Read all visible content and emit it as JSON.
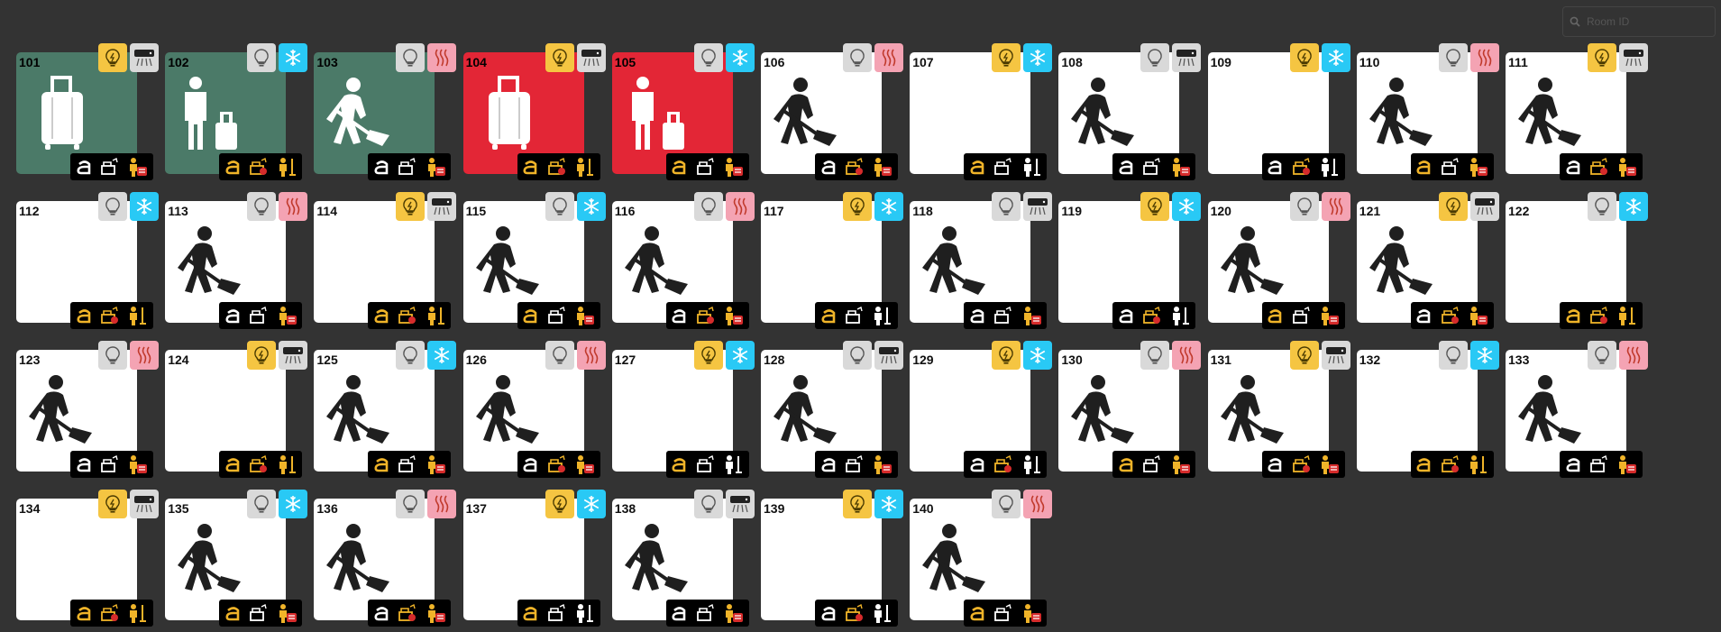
{
  "search": {
    "placeholder": "Room ID"
  },
  "colors": {
    "background": "#333333",
    "vacant": "#ffffff",
    "occupied": "#4b7a68",
    "alert": "#e32636",
    "light_on": "#f5c542",
    "light_off": "#d9d9d9",
    "cool": "#29c9f5",
    "heat": "#f4a3b3",
    "fan": "#d9d9d9"
  },
  "rooms": [
    {
      "number": "101",
      "status": "occupied",
      "hero": "luggage-icon",
      "light": "on",
      "hvac": "fan",
      "tags": [
        "white",
        "white",
        "gold-red"
      ]
    },
    {
      "number": "102",
      "status": "occupied",
      "hero": "guests-icon",
      "light": "off",
      "hvac": "cool",
      "tags": [
        "gold",
        "gold-red",
        "gold-gold"
      ]
    },
    {
      "number": "103",
      "status": "occupied",
      "hero": "cleaning-icon",
      "light": "off",
      "hvac": "heat",
      "tags": [
        "white",
        "white",
        "gold-red"
      ]
    },
    {
      "number": "104",
      "status": "alert",
      "hero": "luggage-icon",
      "light": "on",
      "hvac": "fan",
      "tags": [
        "gold",
        "gold-red",
        "gold-gold"
      ]
    },
    {
      "number": "105",
      "status": "alert",
      "hero": "guests-icon",
      "light": "off",
      "hvac": "cool",
      "tags": [
        "gold",
        "white",
        "gold-red"
      ]
    },
    {
      "number": "106",
      "status": "vacant",
      "hero": "cleaning-icon",
      "light": "off",
      "hvac": "heat",
      "tags": [
        "white",
        "gold-red",
        "gold-red"
      ]
    },
    {
      "number": "107",
      "status": "vacant",
      "hero": "",
      "light": "on",
      "hvac": "cool",
      "tags": [
        "gold",
        "white",
        "white-white"
      ]
    },
    {
      "number": "108",
      "status": "vacant",
      "hero": "cleaning-icon",
      "light": "off",
      "hvac": "fan",
      "tags": [
        "white",
        "white",
        "gold-red"
      ]
    },
    {
      "number": "109",
      "status": "vacant",
      "hero": "",
      "light": "on",
      "hvac": "cool",
      "tags": [
        "white",
        "gold-red",
        "white-white"
      ]
    },
    {
      "number": "110",
      "status": "vacant",
      "hero": "cleaning-icon",
      "light": "off",
      "hvac": "heat",
      "tags": [
        "gold",
        "white",
        "gold-red"
      ]
    },
    {
      "number": "111",
      "status": "vacant",
      "hero": "cleaning-icon",
      "light": "on",
      "hvac": "fan",
      "tags": [
        "white",
        "gold-red",
        "gold-red"
      ]
    },
    {
      "number": "112",
      "status": "vacant",
      "hero": "",
      "light": "off",
      "hvac": "cool",
      "tags": [
        "gold",
        "gold-red",
        "gold-gold"
      ]
    },
    {
      "number": "113",
      "status": "vacant",
      "hero": "cleaning-icon",
      "light": "off",
      "hvac": "heat",
      "tags": [
        "white",
        "white",
        "gold-red"
      ]
    },
    {
      "number": "114",
      "status": "vacant",
      "hero": "",
      "light": "on",
      "hvac": "fan",
      "tags": [
        "gold",
        "gold-red",
        "gold-gold"
      ]
    },
    {
      "number": "115",
      "status": "vacant",
      "hero": "cleaning-icon",
      "light": "off",
      "hvac": "cool",
      "tags": [
        "gold",
        "white",
        "gold-red"
      ]
    },
    {
      "number": "116",
      "status": "vacant",
      "hero": "cleaning-icon",
      "light": "off",
      "hvac": "heat",
      "tags": [
        "white",
        "gold-red",
        "gold-red"
      ]
    },
    {
      "number": "117",
      "status": "vacant",
      "hero": "",
      "light": "on",
      "hvac": "cool",
      "tags": [
        "gold",
        "white",
        "white-white"
      ]
    },
    {
      "number": "118",
      "status": "vacant",
      "hero": "cleaning-icon",
      "light": "off",
      "hvac": "fan",
      "tags": [
        "white",
        "white",
        "gold-red"
      ]
    },
    {
      "number": "119",
      "status": "vacant",
      "hero": "",
      "light": "on",
      "hvac": "cool",
      "tags": [
        "white",
        "gold-red",
        "white-white"
      ]
    },
    {
      "number": "120",
      "status": "vacant",
      "hero": "cleaning-icon",
      "light": "off",
      "hvac": "heat",
      "tags": [
        "gold",
        "white",
        "gold-red"
      ]
    },
    {
      "number": "121",
      "status": "vacant",
      "hero": "cleaning-icon",
      "light": "on",
      "hvac": "fan",
      "tags": [
        "white",
        "gold-red",
        "gold-red"
      ]
    },
    {
      "number": "122",
      "status": "vacant",
      "hero": "",
      "light": "off",
      "hvac": "cool",
      "tags": [
        "gold",
        "gold-red",
        "gold-gold"
      ]
    },
    {
      "number": "123",
      "status": "vacant",
      "hero": "cleaning-icon",
      "light": "off",
      "hvac": "heat",
      "tags": [
        "white",
        "white",
        "gold-red"
      ]
    },
    {
      "number": "124",
      "status": "vacant",
      "hero": "",
      "light": "on",
      "hvac": "fan",
      "tags": [
        "gold",
        "gold-red",
        "gold-gold"
      ]
    },
    {
      "number": "125",
      "status": "vacant",
      "hero": "cleaning-icon",
      "light": "off",
      "hvac": "cool",
      "tags": [
        "gold",
        "white",
        "gold-red"
      ]
    },
    {
      "number": "126",
      "status": "vacant",
      "hero": "cleaning-icon",
      "light": "off",
      "hvac": "heat",
      "tags": [
        "white",
        "gold-red",
        "gold-red"
      ]
    },
    {
      "number": "127",
      "status": "vacant",
      "hero": "",
      "light": "on",
      "hvac": "cool",
      "tags": [
        "gold",
        "white",
        "white-white"
      ]
    },
    {
      "number": "128",
      "status": "vacant",
      "hero": "cleaning-icon",
      "light": "off",
      "hvac": "fan",
      "tags": [
        "white",
        "white",
        "gold-red"
      ]
    },
    {
      "number": "129",
      "status": "vacant",
      "hero": "",
      "light": "on",
      "hvac": "cool",
      "tags": [
        "white",
        "gold-red",
        "white-white"
      ]
    },
    {
      "number": "130",
      "status": "vacant",
      "hero": "cleaning-icon",
      "light": "off",
      "hvac": "heat",
      "tags": [
        "gold",
        "white",
        "gold-red"
      ]
    },
    {
      "number": "131",
      "status": "vacant",
      "hero": "cleaning-icon",
      "light": "on",
      "hvac": "fan",
      "tags": [
        "white",
        "gold-red",
        "gold-red"
      ]
    },
    {
      "number": "132",
      "status": "vacant",
      "hero": "",
      "light": "off",
      "hvac": "cool",
      "tags": [
        "gold",
        "gold-red",
        "gold-gold"
      ]
    },
    {
      "number": "133",
      "status": "vacant",
      "hero": "cleaning-icon",
      "light": "off",
      "hvac": "heat",
      "tags": [
        "white",
        "white",
        "gold-red"
      ]
    },
    {
      "number": "134",
      "status": "vacant",
      "hero": "",
      "light": "on",
      "hvac": "fan",
      "tags": [
        "gold",
        "gold-red",
        "gold-gold"
      ]
    },
    {
      "number": "135",
      "status": "vacant",
      "hero": "cleaning-icon",
      "light": "off",
      "hvac": "cool",
      "tags": [
        "gold",
        "white",
        "gold-red"
      ]
    },
    {
      "number": "136",
      "status": "vacant",
      "hero": "cleaning-icon",
      "light": "off",
      "hvac": "heat",
      "tags": [
        "white",
        "gold-red",
        "gold-red"
      ]
    },
    {
      "number": "137",
      "status": "vacant",
      "hero": "",
      "light": "on",
      "hvac": "cool",
      "tags": [
        "gold",
        "white",
        "white-white"
      ]
    },
    {
      "number": "138",
      "status": "vacant",
      "hero": "cleaning-icon",
      "light": "off",
      "hvac": "fan",
      "tags": [
        "white",
        "white",
        "gold-red"
      ]
    },
    {
      "number": "139",
      "status": "vacant",
      "hero": "",
      "light": "on",
      "hvac": "cool",
      "tags": [
        "white",
        "gold-red",
        "white-white"
      ]
    },
    {
      "number": "140",
      "status": "vacant",
      "hero": "cleaning-icon",
      "light": "off",
      "hvac": "heat",
      "tags": [
        "gold",
        "white",
        "gold-red"
      ]
    }
  ]
}
